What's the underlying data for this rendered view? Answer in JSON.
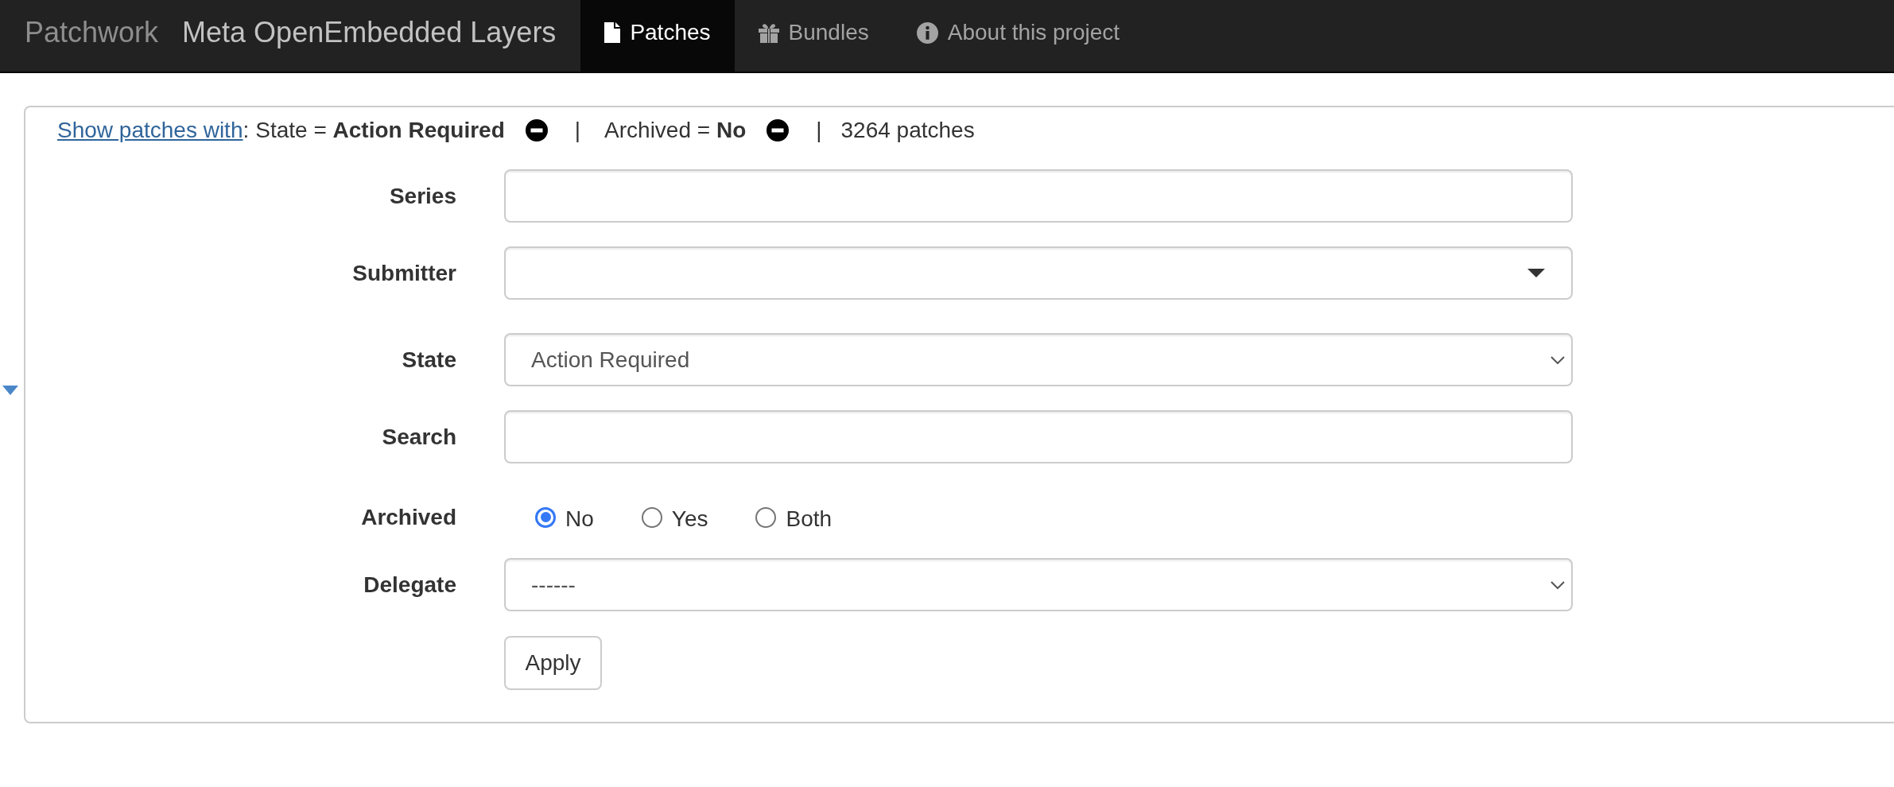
{
  "navbar": {
    "brand": "Patchwork",
    "project": "Meta OpenEmbedded Layers",
    "tabs": [
      {
        "label": "Patches",
        "kind": "file",
        "selected": true
      },
      {
        "label": "Bundles",
        "kind": "gift",
        "selected": false
      },
      {
        "label": "About this project",
        "kind": "info",
        "selected": false
      }
    ]
  },
  "filters": {
    "link": "Show patches with",
    "link_suffix": ":",
    "items": [
      {
        "text": "State = **Action Required**",
        "separator": "|"
      },
      {
        "text": "Archived = **No**",
        "separator": "|"
      }
    ],
    "count": "3264 patches"
  },
  "form": {
    "fields": [
      {
        "label": "Series",
        "kind": "text"
      },
      {
        "label": "Submitter",
        "kind": "combobox"
      },
      {
        "label": "State",
        "kind": "select",
        "value": "Action Required"
      },
      {
        "label": "Search",
        "kind": "text"
      },
      {
        "label": "Archived",
        "kind": "radio",
        "options": [
          {
            "label": "No",
            "selected": true
          },
          {
            "label": "Yes",
            "selected": false
          },
          {
            "label": "Both",
            "selected": false
          }
        ]
      },
      {
        "label": "Delegate",
        "kind": "select",
        "value": "------"
      }
    ],
    "submit": "Apply"
  }
}
